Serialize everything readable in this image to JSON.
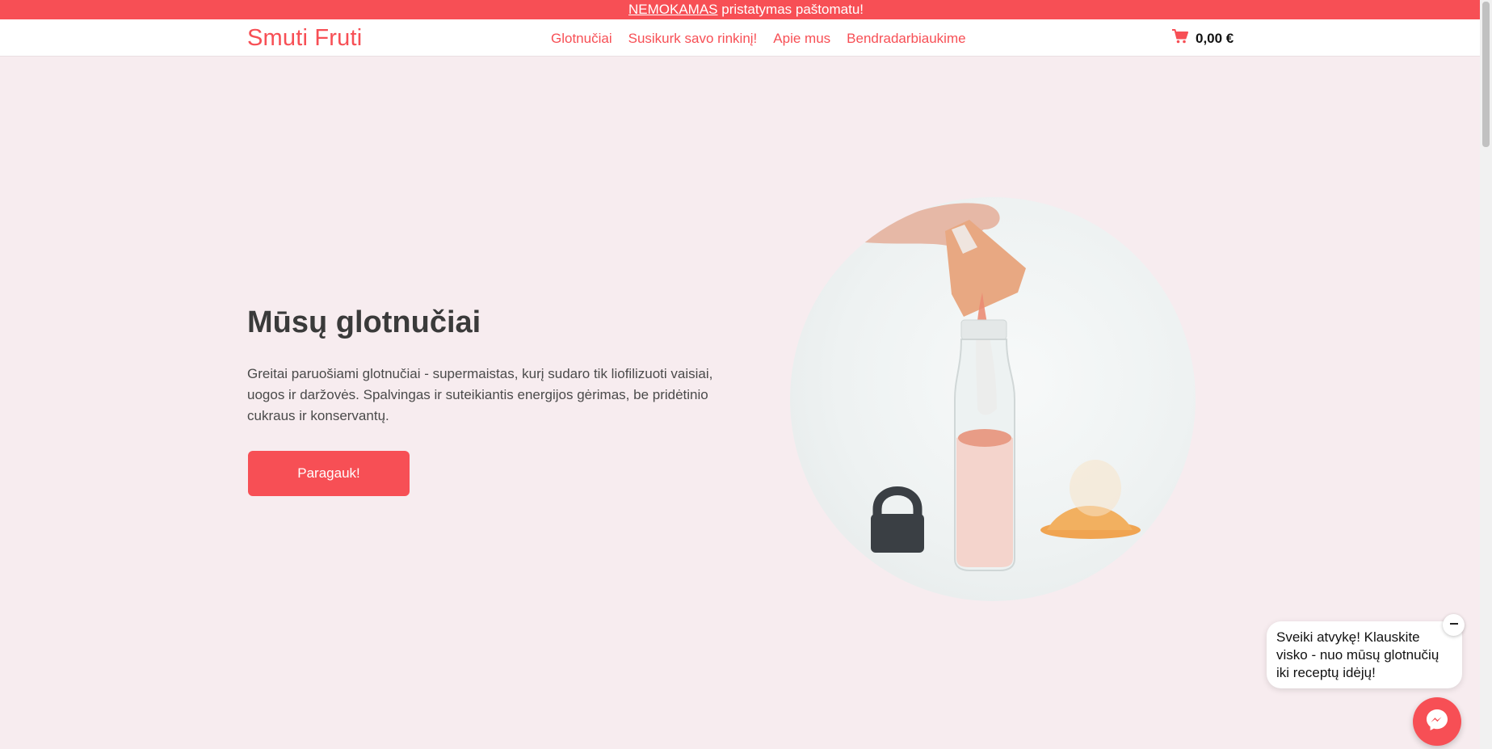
{
  "promo": {
    "highlight": "NEMOKAMAS",
    "text": " pristatymas paštomatu!"
  },
  "header": {
    "logo": "Smuti Fruti",
    "nav": [
      {
        "label": "Glotnučiai"
      },
      {
        "label": "Susikurk savo rinkinį!"
      },
      {
        "label": "Apie mus"
      },
      {
        "label": "Bendradarbiaukime"
      }
    ],
    "cart": {
      "icon": "cart-icon",
      "total": "0,00 €"
    }
  },
  "hero": {
    "title": "Mūsų glotnučiai",
    "description": "Greitai paruošiami glotnučiai - supermaistas, kurį sudaro tik liofilizuoti vaisiai, uogos ir daržovės. Spalvingas ir suteikiantis energijos gėrimas, be pridėtinio cukraus ir konservantų.",
    "cta_label": "Paragauk!"
  },
  "chat": {
    "message": "Sveiki atvykę! Klauskite visko - nuo mūsų glotnučių iki receptų idėjų!",
    "button_icon": "messenger-icon",
    "close_icon": "minus-icon"
  },
  "colors": {
    "accent": "#f74f55",
    "background": "#f7ecef"
  }
}
